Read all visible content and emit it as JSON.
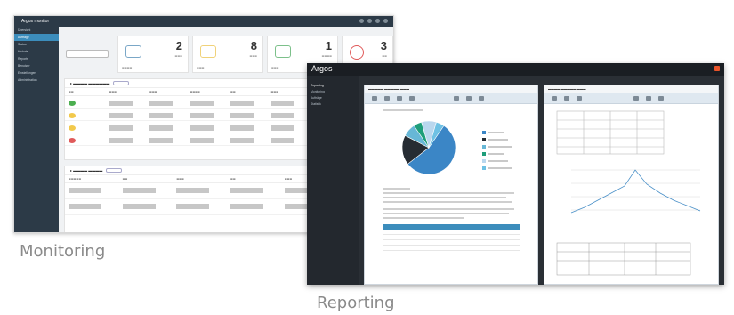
{
  "captions": {
    "monitoring": "Monitoring",
    "reporting": "Reporting"
  },
  "monitoring": {
    "app_title": "Argos monitor",
    "sidebar": [
      "Übersicht",
      "Aufträge",
      "Status",
      "Historie",
      "Reports",
      "Benutzer",
      "Einstellungen",
      "Administration"
    ],
    "kpis": [
      {
        "value": "2",
        "accent": "#7aa7c7"
      },
      {
        "value": "8",
        "accent": "#f0d27a"
      },
      {
        "value": "1",
        "accent": "#7cc08a"
      },
      {
        "value": "3",
        "accent": "#e05a5a"
      }
    ],
    "row_status_colors": [
      "#4caf50",
      "#f2c94c",
      "#f2c94c",
      "#e05a5a"
    ]
  },
  "reporting": {
    "app_title": "Argos",
    "accent": "#e8542a",
    "sidebar": [
      "Reporting",
      "Monitoring",
      "Aufträge",
      "Statistik"
    ],
    "pie_colors": [
      "#3b86c6",
      "#262c33",
      "#67b7d6",
      "#1e9e7a",
      "#b9d7ee",
      "#6ec1e4"
    ],
    "pie_values": [
      55,
      18,
      8,
      5,
      9,
      5
    ]
  }
}
